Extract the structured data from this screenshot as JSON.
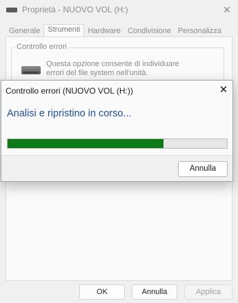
{
  "background_window": {
    "title": "Proprietà - NUOVO VOL (H:)",
    "close_glyph": "✕",
    "tabs": [
      {
        "label": "Generale",
        "active": false
      },
      {
        "label": "Strumenti",
        "active": true
      },
      {
        "label": "Hardware",
        "active": false
      },
      {
        "label": "Condivisione",
        "active": false
      },
      {
        "label": "Personalizza",
        "active": false
      }
    ],
    "error_check_group": {
      "label": "Controllo errori",
      "description_line1": "Questa opzione consente di individuare",
      "description_line2": "errori del file system nell'unità."
    },
    "buttons": {
      "ok": "OK",
      "cancel": "Annulla",
      "apply": "Applica"
    }
  },
  "dialog": {
    "title": "Controllo errori (NUOVO VOL (H:))",
    "close_glyph": "✕",
    "heading": "Analisi e ripristino in corso...",
    "progress_percent": 71,
    "cancel_label": "Annulla",
    "colors": {
      "heading": "#1f4e9a",
      "progress_fill": "#0e7a17"
    }
  }
}
